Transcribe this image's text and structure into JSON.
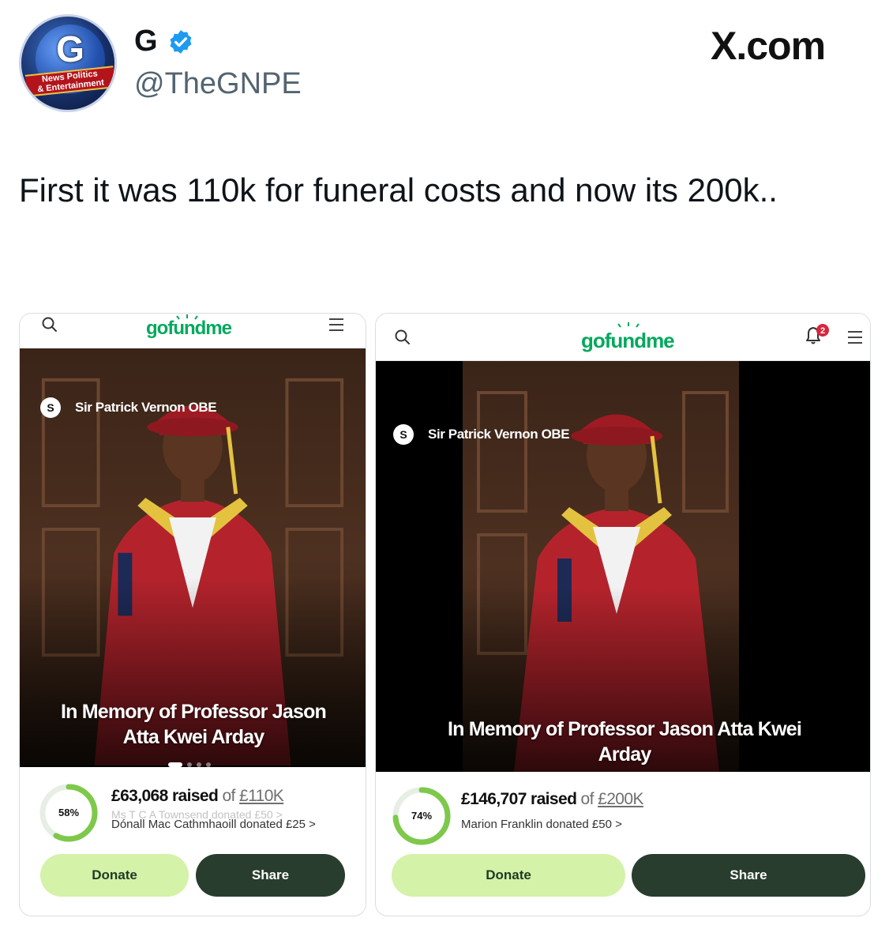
{
  "tweet": {
    "display_name": "G",
    "handle": "@TheGNPE",
    "watermark": "X.com",
    "text": "First it was 110k for funeral costs and now its 200k..",
    "avatar_text": [
      "G",
      "News Politics",
      "& Entertainment"
    ]
  },
  "cards": [
    {
      "logo": "gofundme",
      "creator_initial": "S",
      "creator": "Sir Patrick Vernon OBE",
      "caption": "In Memory of Professor Jason Atta Kwei Arday",
      "percent_label": "58%",
      "progress": 0.58,
      "raised": "£63,068 raised",
      "of": "of",
      "goal": "£110K",
      "donor_faded": "Ms T C A Townsend donated £50 >",
      "donor": "Dónall Mac Cathmhaoill donated £25 >",
      "donate_label": "Donate",
      "share_label": "Share"
    },
    {
      "logo": "gofundme",
      "creator_initial": "S",
      "creator": "Sir Patrick Vernon OBE",
      "caption": "In Memory of Professor Jason Atta Kwei Arday",
      "percent_label": "74%",
      "progress": 0.74,
      "notifications": "2",
      "raised": "£146,707 raised",
      "of": "of",
      "goal": "£200K",
      "donor": "Marion Franklin donated £50 >",
      "donate_label": "Donate",
      "share_label": "Share"
    }
  ],
  "colors": {
    "brand_green": "#02a95c",
    "donate_bg": "#d4f2a8",
    "share_bg": "#283d2e",
    "verified_blue": "#1d9bf0",
    "robe_red": "#b4232c"
  },
  "icons": [
    "verified-badge-icon",
    "search-icon",
    "hamburger-menu-icon",
    "notification-bell-icon"
  ]
}
